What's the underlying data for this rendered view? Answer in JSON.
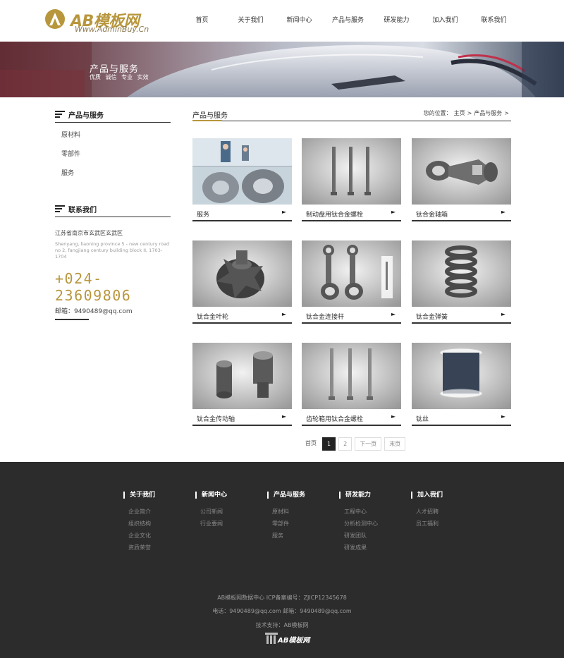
{
  "brand": {
    "name": "AB模板网",
    "url": "Www.AdminBuy.Cn"
  },
  "nav": [
    {
      "label": "首页"
    },
    {
      "label": "关于我们"
    },
    {
      "label": "新闻中心"
    },
    {
      "label": "产品与服务"
    },
    {
      "label": "研发能力"
    },
    {
      "label": "加入我们"
    },
    {
      "label": "联系我们"
    }
  ],
  "banner": {
    "title": "产品与服务",
    "subtitle": "优质 诚信 专业 实效"
  },
  "sidebar": {
    "title": "产品与服务",
    "items": [
      {
        "label": "原材料"
      },
      {
        "label": "零部件"
      },
      {
        "label": "服务"
      }
    ],
    "contact": {
      "title": "联系我们",
      "address": "江苏省南京市玄武区玄武区",
      "address_en": "Shenyang, liaoning province 5 - new century road no 2, fangjiang century building block II, 1703-1704",
      "phone": "+024-23609806",
      "email": "邮箱：9490489@qq.com"
    }
  },
  "main": {
    "title": "产品与服务",
    "breadcrumb": {
      "prefix": "您的位置：",
      "home": "主页",
      "sep": ">",
      "current": "产品与服务",
      "tail": ">"
    }
  },
  "products": [
    {
      "name": "服务",
      "icon": "factory-photo"
    },
    {
      "name": "制动盘用钛合金螺栓",
      "icon": "bolt-photo"
    },
    {
      "name": "钛合金轴箱",
      "icon": "axle-box-photo"
    },
    {
      "name": "钛合金叶轮",
      "icon": "impeller-photo"
    },
    {
      "name": "钛合金连接杆",
      "icon": "connecting-rod-photo"
    },
    {
      "name": "钛合金弹簧",
      "icon": "spring-photo"
    },
    {
      "name": "钛合金传动轴",
      "icon": "shaft-photo"
    },
    {
      "name": "齿轮箱用钛合金螺栓",
      "icon": "gearbox-bolt-photo"
    },
    {
      "name": "钛丝",
      "icon": "wire-spool-photo"
    }
  ],
  "card_arrow": "►",
  "pagination": {
    "first": "首页",
    "pages": [
      "1",
      "2"
    ],
    "next": "下一页",
    "last": "末页"
  },
  "footer": {
    "columns": [
      {
        "title": "关于我们",
        "links": [
          "企业简介",
          "组织结构",
          "企业文化",
          "资质荣誉"
        ]
      },
      {
        "title": "新闻中心",
        "links": [
          "公司新闻",
          "行业要闻"
        ]
      },
      {
        "title": "产品与服务",
        "links": [
          "原材料",
          "零部件",
          "服务"
        ]
      },
      {
        "title": "研发能力",
        "links": [
          "工程中心",
          "分析检测中心",
          "研发团队",
          "研发成果"
        ]
      },
      {
        "title": "加入我们",
        "links": [
          "人才招聘",
          "员工福利"
        ]
      }
    ],
    "line1": "AB模板网数据中心   ICP备案编号：ZJICP12345678",
    "line2": "电话：9490489@qq.com    邮箱：9490489@qq.com",
    "line3": "技术支持：AB模板网",
    "logo_text": "AB模板网"
  },
  "colors": {
    "accent": "#b8963c",
    "footer_bg": "#2c2c2c",
    "text": "#333333"
  }
}
